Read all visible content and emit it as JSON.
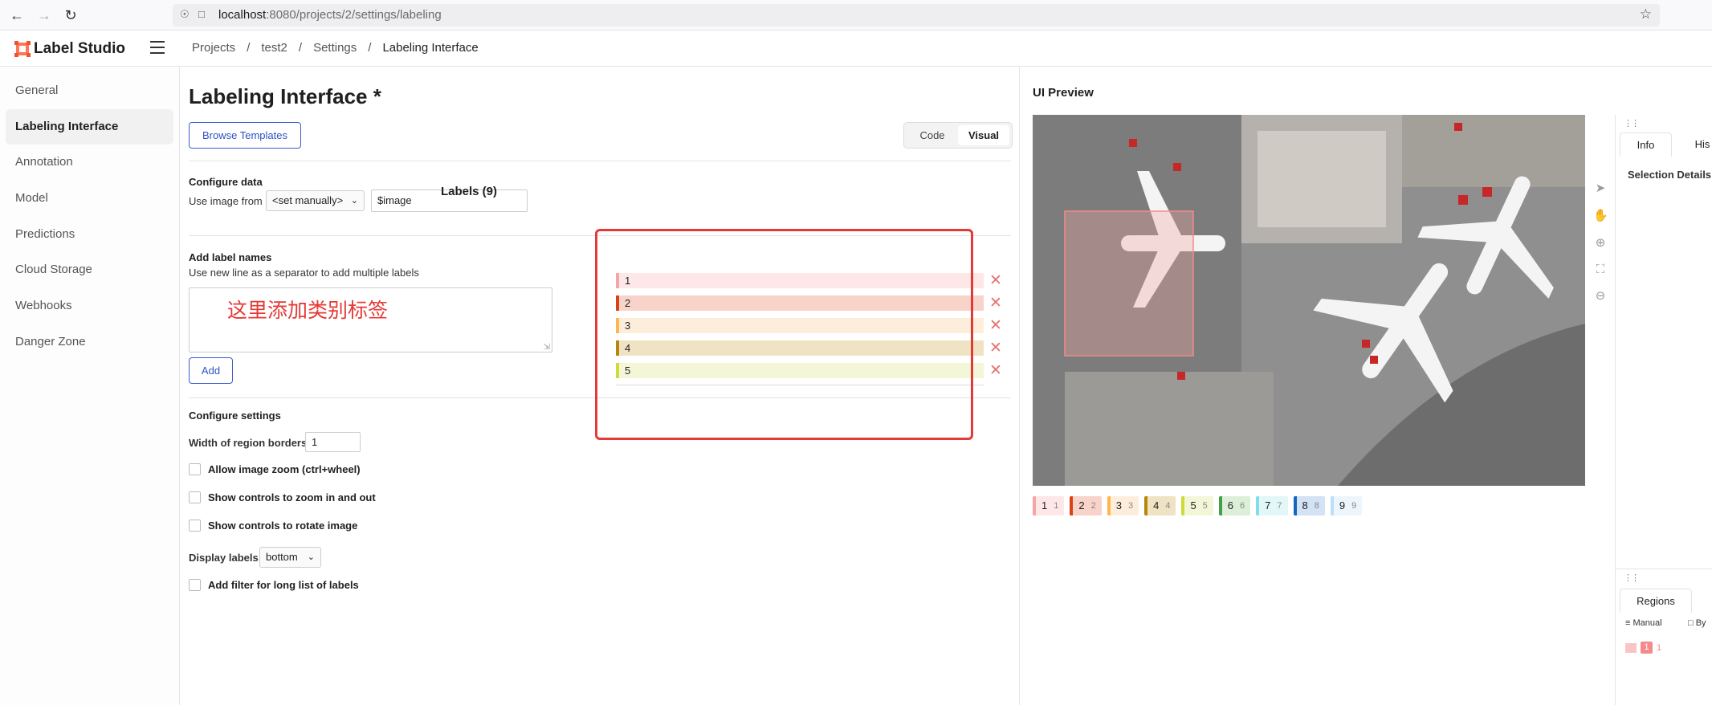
{
  "browser": {
    "url_host": "localhost",
    "url_path": ":8080/projects/2/settings/labeling"
  },
  "app": {
    "logo_text": "Label Studio",
    "breadcrumb": [
      "Projects",
      "/",
      "test2",
      "/",
      "Settings",
      "/",
      "Labeling Interface"
    ]
  },
  "sidebar": {
    "items": [
      {
        "label": "General"
      },
      {
        "label": "Labeling Interface"
      },
      {
        "label": "Annotation"
      },
      {
        "label": "Model"
      },
      {
        "label": "Predictions"
      },
      {
        "label": "Cloud Storage"
      },
      {
        "label": "Webhooks"
      },
      {
        "label": "Danger Zone"
      }
    ],
    "active_index": 1
  },
  "config": {
    "title": "Labeling Interface *",
    "browse_templates": "Browse Templates",
    "mode_code": "Code",
    "mode_visual": "Visual",
    "configure_data": "Configure data",
    "use_image_from": "Use image from",
    "source_select": "<set manually>",
    "source_value": "$image",
    "add_label_names": "Add label names",
    "label_hint": "Use new line as a separator to add multiple labels",
    "textarea_annotation": "这里添加类别标签",
    "add_button": "Add",
    "labels_title": "Labels (9)",
    "labels": [
      {
        "name": "1",
        "color": "#f4a5a5",
        "bg": "#fde7e7"
      },
      {
        "name": "2",
        "color": "#d84315",
        "bg": "#f7d3ca"
      },
      {
        "name": "3",
        "color": "#ffb74d",
        "bg": "#fdeedc"
      },
      {
        "name": "4",
        "color": "#b8860b",
        "bg": "#efe3c4"
      },
      {
        "name": "5",
        "color": "#cddc39",
        "bg": "#f3f7d8"
      }
    ],
    "configure_settings": "Configure settings",
    "width_label": "Width of region borders",
    "width_value": "1",
    "opt_zoom": "Allow image zoom (ctrl+wheel)",
    "opt_zoom_controls": "Show controls to zoom in and out",
    "opt_rotate": "Show controls to rotate image",
    "display_labels_label": "Display labels:",
    "display_labels_value": "bottom",
    "opt_filter": "Add filter for long list of labels"
  },
  "preview": {
    "title": "UI Preview",
    "label_tags": [
      {
        "name": "1",
        "key": "1",
        "color": "#f4a5a5",
        "bg": "#fde7e7"
      },
      {
        "name": "2",
        "key": "2",
        "color": "#d84315",
        "bg": "#f7d3ca"
      },
      {
        "name": "3",
        "key": "3",
        "color": "#ffb74d",
        "bg": "#fdeedc"
      },
      {
        "name": "4",
        "key": "4",
        "color": "#b8860b",
        "bg": "#efe3c4"
      },
      {
        "name": "5",
        "key": "5",
        "color": "#cddc39",
        "bg": "#f3f7d8"
      },
      {
        "name": "6",
        "key": "6",
        "color": "#43a047",
        "bg": "#dcefd9"
      },
      {
        "name": "7",
        "key": "7",
        "color": "#80deea",
        "bg": "#e3f7f9"
      },
      {
        "name": "8",
        "key": "8",
        "color": "#1565c0",
        "bg": "#d3e2f4"
      },
      {
        "name": "9",
        "key": "9",
        "color": "#bbdefb",
        "bg": "#eef6fd"
      }
    ]
  },
  "right_panel": {
    "tab_info": "Info",
    "tab_history": "His",
    "selection_details": "Selection Details",
    "regions_tab": "Regions",
    "manual": "Manual",
    "by": "By",
    "region_label": "1",
    "region_key": "1"
  },
  "colors": {
    "accent": "#2f52c4",
    "annotation_red": "#e53935"
  }
}
